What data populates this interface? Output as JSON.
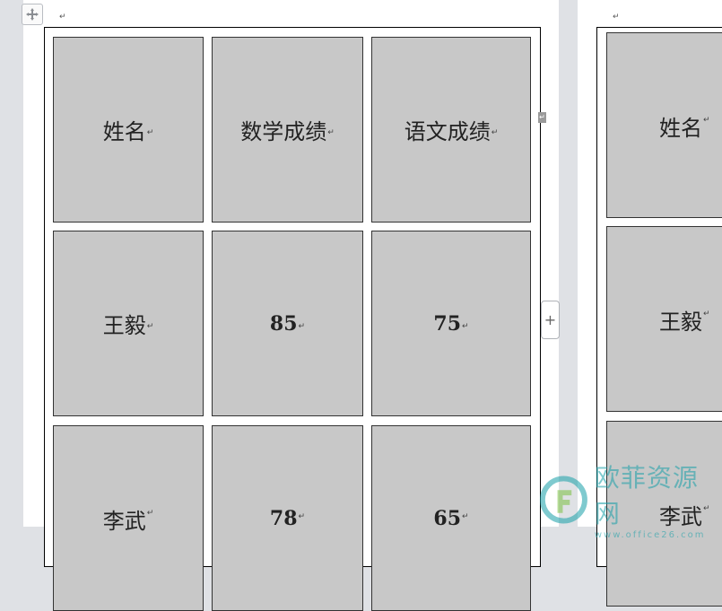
{
  "table": {
    "rows": [
      [
        "姓名",
        "数学成绩",
        "语文成绩"
      ],
      [
        "王毅",
        "85",
        "75"
      ],
      [
        "李武",
        "78",
        "65"
      ]
    ],
    "paragraph_mark": "↵"
  },
  "second_page": {
    "cells": [
      "姓名",
      "王毅",
      "李武"
    ]
  },
  "controls": {
    "add_column_label": "+"
  },
  "watermark": {
    "brand": "欧菲资源网",
    "url": "www.office26.com"
  },
  "colors": {
    "cell_fill": "#c8c8c8",
    "workspace": "#dfe1e5",
    "watermark": "#18a0a8"
  }
}
